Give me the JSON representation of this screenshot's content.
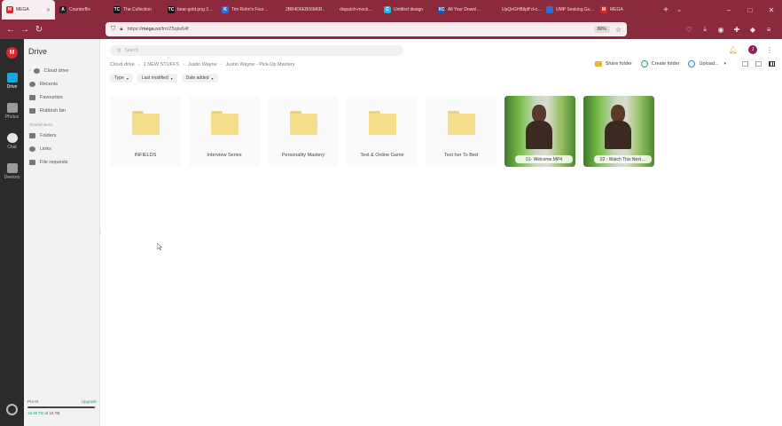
{
  "browser": {
    "tabs": [
      {
        "label": "MEGA",
        "active": true,
        "favicon_color": "#d9272e",
        "favicon_glyph": "M"
      },
      {
        "label": "Counterflix",
        "active": false,
        "favicon_color": "#222222",
        "favicon_glyph": "A"
      },
      {
        "label": "The Collection",
        "active": false,
        "favicon_color": "#111111",
        "favicon_glyph": "TC"
      },
      {
        "label": "bear-gold.png 3…",
        "active": false,
        "favicon_color": "#111111",
        "favicon_glyph": "TC"
      },
      {
        "label": "Tim Rohn's Four…",
        "active": false,
        "favicon_color": "#2d6fd8",
        "favicon_glyph": "K"
      },
      {
        "label": "2BB4D6EB06M6R…",
        "active": false,
        "favicon_color": "#8b2a3c",
        "favicon_glyph": ""
      },
      {
        "label": "dispatch-mock…",
        "active": false,
        "favicon_color": "#8b2a3c",
        "favicon_glyph": ""
      },
      {
        "label": "Untitled design",
        "active": false,
        "favicon_color": "#2ab3e6",
        "favicon_glyph": "C"
      },
      {
        "label": "All Your Downl…",
        "active": false,
        "favicon_color": "#2254b8",
        "favicon_glyph": "XC"
      },
      {
        "label": "UpQeGHBilpff d-o…",
        "active": false,
        "favicon_color": "#8b2a3c",
        "favicon_glyph": ""
      },
      {
        "label": "UMP Seeking Gu…",
        "active": false,
        "favicon_color": "#2d6fd8",
        "favicon_glyph": ""
      },
      {
        "label": "MEGA",
        "active": false,
        "favicon_color": "#d9272e",
        "favicon_glyph": "M"
      }
    ],
    "url_prefix": "https://",
    "url_domain": "mega.nz",
    "url_path": "/fm/Z5qlw54f",
    "zoom": "80%"
  },
  "rail": {
    "logo": "M",
    "items": [
      {
        "label": "Drive",
        "active": true
      },
      {
        "label": "Photos",
        "active": false
      },
      {
        "label": "Chat",
        "active": false
      },
      {
        "label": "Devices",
        "active": false
      }
    ]
  },
  "sidebar": {
    "title": "Drive",
    "items": [
      {
        "label": "Cloud drive"
      },
      {
        "label": "Recents"
      },
      {
        "label": "Favourites"
      },
      {
        "label": "Rubbish bin"
      }
    ],
    "section_label": "Shared items",
    "shared_items": [
      {
        "label": "Folders"
      },
      {
        "label": "Links"
      },
      {
        "label": "File requests"
      }
    ],
    "storage": {
      "plan": "Pro III",
      "upgrade": "Upgrade",
      "used": "16.95 TB",
      "total": "of 16 TB",
      "used_fraction": 0.98
    }
  },
  "main": {
    "search_placeholder": "Search",
    "avatar_initial": "J",
    "breadcrumb": [
      "Cloud drive",
      "1 NEW STUFFS",
      "Justin Wayne",
      "Justin Wayne - Pick-Up Mastery"
    ],
    "actions": {
      "share": "Share folder",
      "create": "Create folder",
      "upload": "Upload..."
    },
    "filters": [
      "Type",
      "Last modified",
      "Date added"
    ],
    "items": [
      {
        "name": "INFIELDS",
        "type": "folder"
      },
      {
        "name": "Interview Series",
        "type": "folder"
      },
      {
        "name": "Personality Mastery",
        "type": "folder"
      },
      {
        "name": "Text & Online Game",
        "type": "folder"
      },
      {
        "name": "Text her To Bed",
        "type": "folder"
      },
      {
        "name": "01- Welcome.MP4",
        "type": "video"
      },
      {
        "name": "02 - Watch This Next…",
        "type": "video"
      }
    ]
  }
}
